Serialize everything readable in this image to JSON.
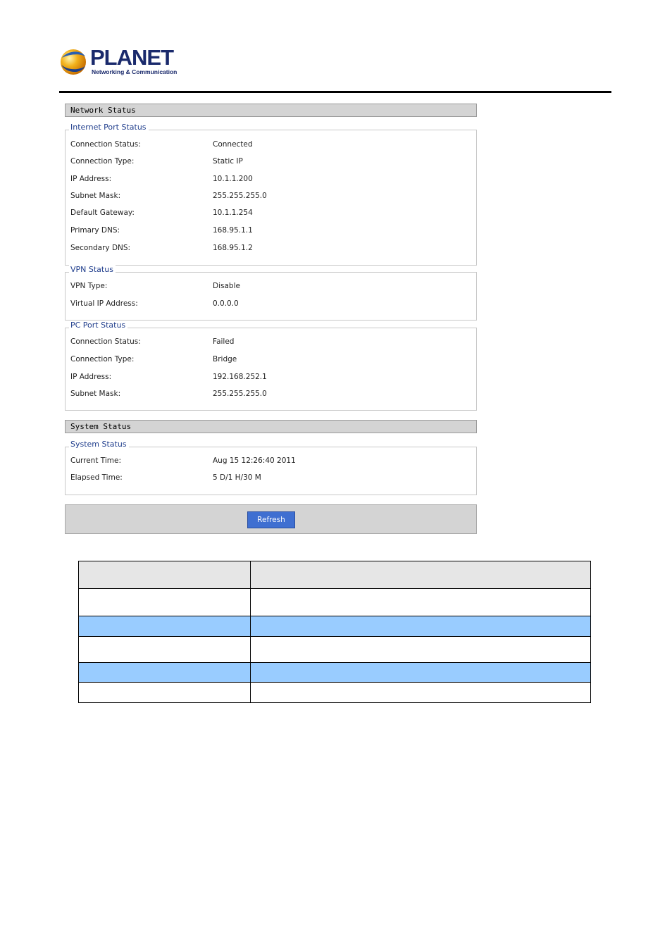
{
  "brand": {
    "name": "PLANET",
    "tagline": "Networking & Communication"
  },
  "network_status": {
    "title": "Network Status",
    "internet_port": {
      "legend": "Internet Port Status",
      "rows": [
        {
          "label": "Connection Status:",
          "value": "Connected"
        },
        {
          "label": "Connection Type:",
          "value": "Static IP"
        },
        {
          "label": "IP Address:",
          "value": "10.1.1.200"
        },
        {
          "label": "Subnet Mask:",
          "value": "255.255.255.0"
        },
        {
          "label": "Default Gateway:",
          "value": "10.1.1.254"
        },
        {
          "label": "Primary DNS:",
          "value": "168.95.1.1"
        },
        {
          "label": "Secondary DNS:",
          "value": "168.95.1.2"
        }
      ]
    },
    "vpn": {
      "legend": "VPN Status",
      "rows": [
        {
          "label": "VPN Type:",
          "value": "Disable"
        },
        {
          "label": "Virtual IP Address:",
          "value": "0.0.0.0"
        }
      ]
    },
    "pc_port": {
      "legend": "PC Port Status",
      "rows": [
        {
          "label": "Connection Status:",
          "value": "Failed"
        },
        {
          "label": "Connection Type:",
          "value": "Bridge"
        },
        {
          "label": "IP Address:",
          "value": "192.168.252.1"
        },
        {
          "label": "Subnet Mask:",
          "value": "255.255.255.0"
        }
      ]
    }
  },
  "system_status": {
    "title": "System Status",
    "legend": "System Status",
    "rows": [
      {
        "label": "Current Time:",
        "value": "Aug 15 12:26:40 2011"
      },
      {
        "label": "Elapsed Time:",
        "value": "5 D/1 H/30 M"
      }
    ]
  },
  "actions": {
    "refresh_label": "Refresh"
  },
  "colors": {
    "header_gray": "#d4d4d4",
    "legend_blue": "#1f3d8c",
    "button_blue": "#3f6fd1",
    "table_highlight": "#99ccff"
  }
}
